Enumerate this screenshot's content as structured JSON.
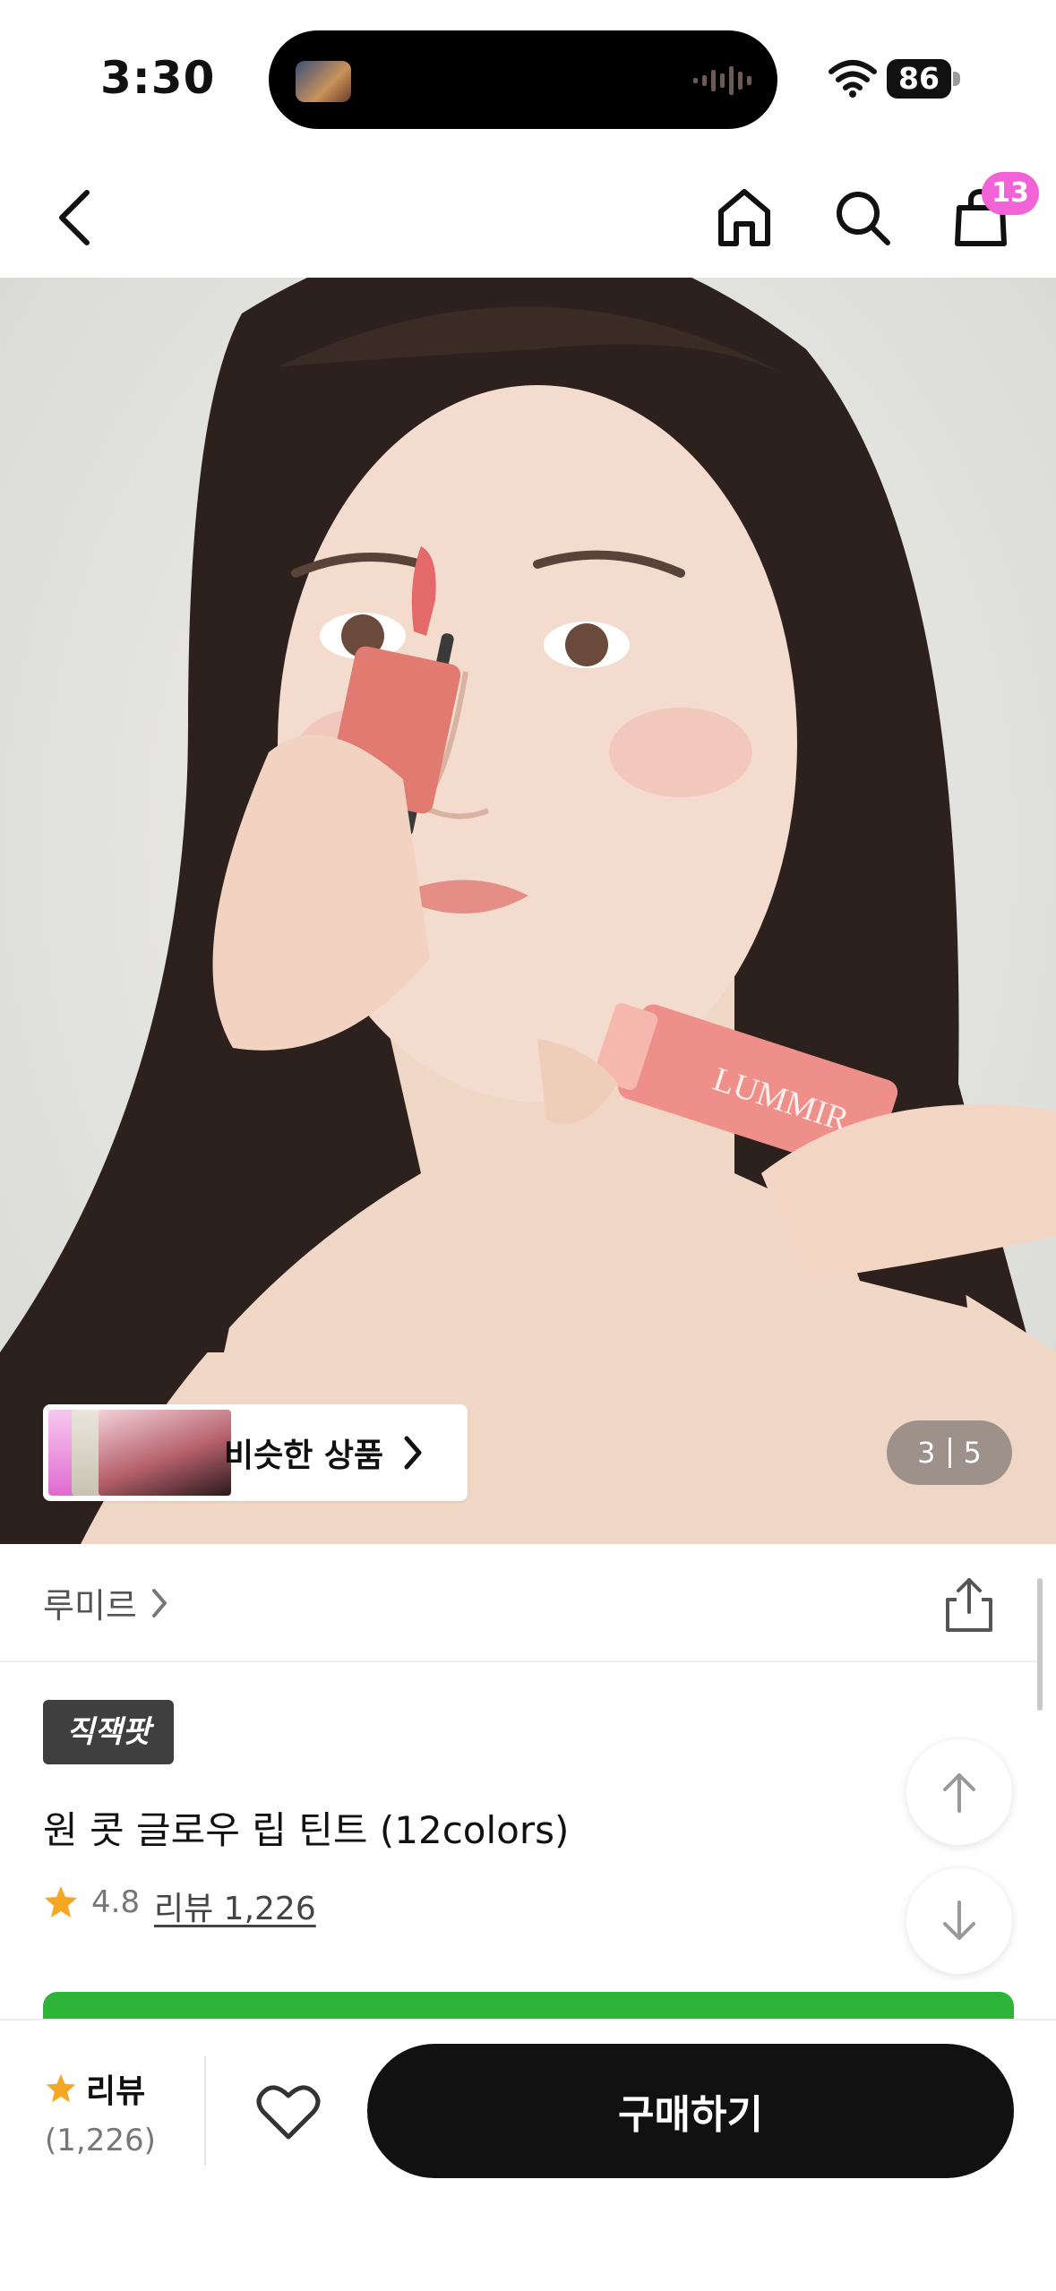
{
  "status_bar": {
    "time": "3:30",
    "battery": "86"
  },
  "nav": {
    "cart_count": "13"
  },
  "hero": {
    "similar_label": "비슷한 상품",
    "counter_current": "3",
    "counter_total": "5",
    "product_print": "LUMMIR"
  },
  "brand": {
    "name": "루미르"
  },
  "product": {
    "tag": "직잭팟",
    "title": "원 콧 글로우 립 틴트 (12colors)",
    "rating": "4.8",
    "reviews_link": "리뷰 1,226"
  },
  "bottom_bar": {
    "review_label": "리뷰",
    "review_count": "(1,226)",
    "buy_label": "구매하기"
  },
  "colors": {
    "badge": "#f163d6",
    "accent_green": "#2fb43a",
    "star": "#f5a623",
    "buy_button": "#111111"
  }
}
